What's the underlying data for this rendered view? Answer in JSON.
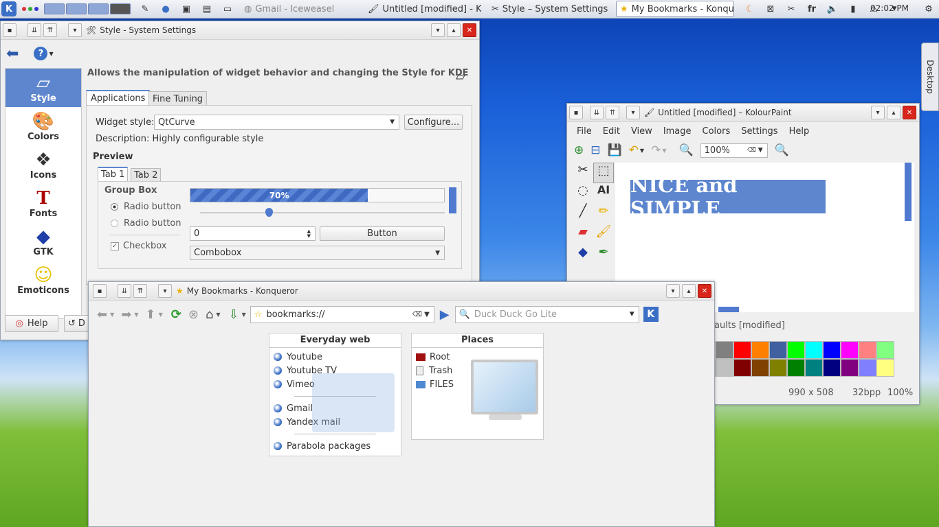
{
  "panel": {
    "k_menu": "K",
    "tasks": [
      {
        "label": "Gmail - Iceweasel",
        "icon": "iceweasel-icon"
      },
      {
        "label": "Untitled [modified] - Ko",
        "icon": "kolourpaint-icon"
      },
      {
        "label": "Style – System Settings",
        "icon": "settings-icon"
      },
      {
        "label": "My Bookmarks - Konqu",
        "icon": "star-icon"
      }
    ],
    "keyboard_layout": "fr",
    "clock": "02:02 PM"
  },
  "desktop": {
    "side_tab": "Desktop"
  },
  "settings": {
    "title": "Style - System Settings",
    "header": "Allows the manipulation of widget behavior and changing the Style for KDE",
    "sidebar": [
      {
        "label": "Style",
        "icon": "style-icon"
      },
      {
        "label": "Colors",
        "icon": "colors-icon"
      },
      {
        "label": "Icons",
        "icon": "icons-icon"
      },
      {
        "label": "Fonts",
        "icon": "fonts-icon"
      },
      {
        "label": "GTK",
        "icon": "gtk-icon"
      },
      {
        "label": "Emoticons",
        "icon": "emoticons-icon"
      }
    ],
    "tabs": [
      "Applications",
      "Fine Tuning"
    ],
    "widget_style_label": "Widget style:",
    "widget_style_value": "QtCurve",
    "configure_button": "Configure...",
    "description": "Description: Highly configurable style",
    "preview_label": "Preview",
    "preview_tabs": [
      "Tab 1",
      "Tab 2"
    ],
    "group_box": "Group Box",
    "radio1": "Radio button",
    "radio2": "Radio button",
    "checkbox": "Checkbox",
    "progress_text": "70%",
    "progress_value": 0.7,
    "spin_value": "0",
    "button_label": "Button",
    "combobox_value": "Combobox",
    "help_button": "Help",
    "defaults_button": "D"
  },
  "kolour": {
    "title": "Untitled [modified] – KolourPaint",
    "menu": [
      "File",
      "Edit",
      "View",
      "Image",
      "Colors",
      "Settings",
      "Help"
    ],
    "zoom": "100%",
    "canvas_text": "NICE and SIMPLE",
    "status_left": "aults [modified]",
    "dims": "990 x 508",
    "bpp": "32bpp",
    "zoom_status": "100%",
    "palette_row1": [
      "#000000",
      "#808080",
      "#ff0000",
      "#ff8000",
      "#4060a0",
      "#00ff00",
      "#00ffff",
      "#0000ff",
      "#ff00ff",
      "#ff8080",
      "#80ff80"
    ],
    "palette_row2": [
      "#ffffff",
      "#c0c0c0",
      "#800000",
      "#804000",
      "#808000",
      "#008000",
      "#008080",
      "#000080",
      "#800080",
      "#8080ff",
      "#ffff80"
    ]
  },
  "konq": {
    "title": "My Bookmarks - Konqueror",
    "address": "bookmarks://",
    "search_placeholder": "Duck Duck Go Lite",
    "everyday_title": "Everyday web",
    "everyday_items": [
      "Youtube",
      "Youtube TV",
      "Vimeo",
      "Gmail",
      "Yandex mail",
      "Parabola packages"
    ],
    "places_title": "Places",
    "places_items": [
      "Root",
      "Trash",
      "FILES"
    ]
  }
}
